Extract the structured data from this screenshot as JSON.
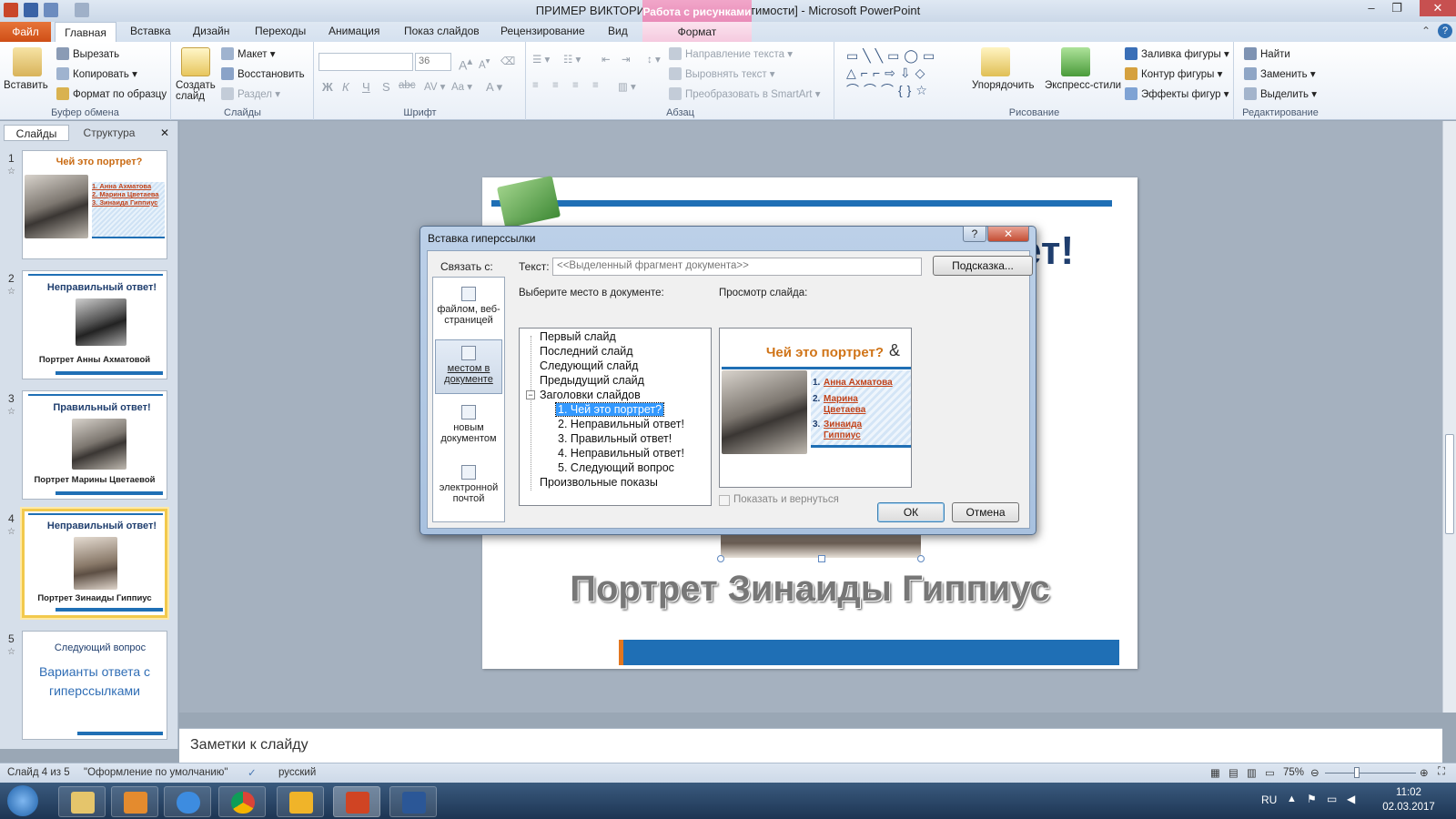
{
  "window": {
    "title": "ПРИМЕР ВИКТОРИНЫ [Режим совместимости] - Microsoft PowerPoint",
    "context_tab_group": "Работа с рисунками"
  },
  "ribbon_tabs": [
    "Файл",
    "Главная",
    "Вставка",
    "Дизайн",
    "Переходы",
    "Анимация",
    "Показ слайдов",
    "Рецензирование",
    "Вид",
    "Формат"
  ],
  "ribbon": {
    "clipboard": {
      "paste": "Вставить",
      "cut": "Вырезать",
      "copy": "Копировать",
      "format_painter": "Формат по образцу",
      "label": "Буфер обмена"
    },
    "slides": {
      "new_slide": "Создать слайд",
      "layout": "Макет",
      "reset": "Восстановить",
      "section": "Раздел",
      "label": "Слайды"
    },
    "font": {
      "size": "36",
      "label": "Шрифт"
    },
    "paragraph": {
      "text_direction": "Направление текста",
      "align_text": "Выровнять текст",
      "smartart": "Преобразовать в SmartArt",
      "label": "Абзац"
    },
    "drawing": {
      "arrange": "Упорядочить",
      "quick_styles": "Экспресс-стили",
      "shape_fill": "Заливка фигуры",
      "shape_outline": "Контур фигуры",
      "shape_effects": "Эффекты фигур",
      "label": "Рисование"
    },
    "editing": {
      "find": "Найти",
      "replace": "Заменить",
      "select": "Выделить",
      "label": "Редактирование"
    }
  },
  "pane_tabs": {
    "slides": "Слайды",
    "outline": "Структура"
  },
  "thumbnails": [
    {
      "num": "1",
      "title": "Чей это портрет?",
      "answers": [
        "1. Анна Ахматова",
        "2. Марина Цветаева",
        "3. Зинаида Гиппиус"
      ]
    },
    {
      "num": "2",
      "title": "Неправильный ответ!",
      "caption": "Портрет Анны Ахматовой"
    },
    {
      "num": "3",
      "title": "Правильный ответ!",
      "caption": "Портрет Марины Цветаевой"
    },
    {
      "num": "4",
      "title": "Неправильный ответ!",
      "caption": "Портрет Зинаиды Гиппиус"
    },
    {
      "num": "5",
      "title": "Следующий вопрос",
      "body": "Варианты ответа с гиперссылками"
    }
  ],
  "slide": {
    "title_partial": "ет!",
    "caption": "Портрет Зинаиды Гиппиус"
  },
  "notes_placeholder": "Заметки к слайду",
  "status": {
    "slide_info": "Слайд 4 из 5",
    "theme": "\"Оформление по умолчанию\"",
    "language": "русский",
    "zoom": "75%"
  },
  "dialog": {
    "title": "Вставка гиперссылки",
    "link_to_label": "Связать с:",
    "link_options": [
      "файлом, веб-страницей",
      "местом в документе",
      "новым документом",
      "электронной почтой"
    ],
    "text_label": "Текст:",
    "text_value": "<<Выделенный фрагмент документа>>",
    "tooltip_button": "Подсказка...",
    "place_label": "Выберите место в документе:",
    "tree": [
      "Первый слайд",
      "Последний слайд",
      "Следующий слайд",
      "Предыдущий слайд",
      "Заголовки слайдов",
      "1. Чей это портрет?",
      "2. Неправильный ответ!",
      "3. Правильный ответ!",
      "4. Неправильный ответ!",
      "5. Следующий вопрос",
      "Произвольные показы"
    ],
    "preview_label": "Просмотр слайда:",
    "preview_title": "Чей это портрет?",
    "preview_answers": [
      "Анна Ахматова",
      "Марина Цветаева",
      "Зинаида Гиппиус"
    ],
    "show_return": "Показать и вернуться",
    "ok": "ОК",
    "cancel": "Отмена",
    "help": "?",
    "close": "✕"
  },
  "taskbar": {
    "lang": "RU",
    "time": "11:02",
    "date": "02.03.2017"
  }
}
